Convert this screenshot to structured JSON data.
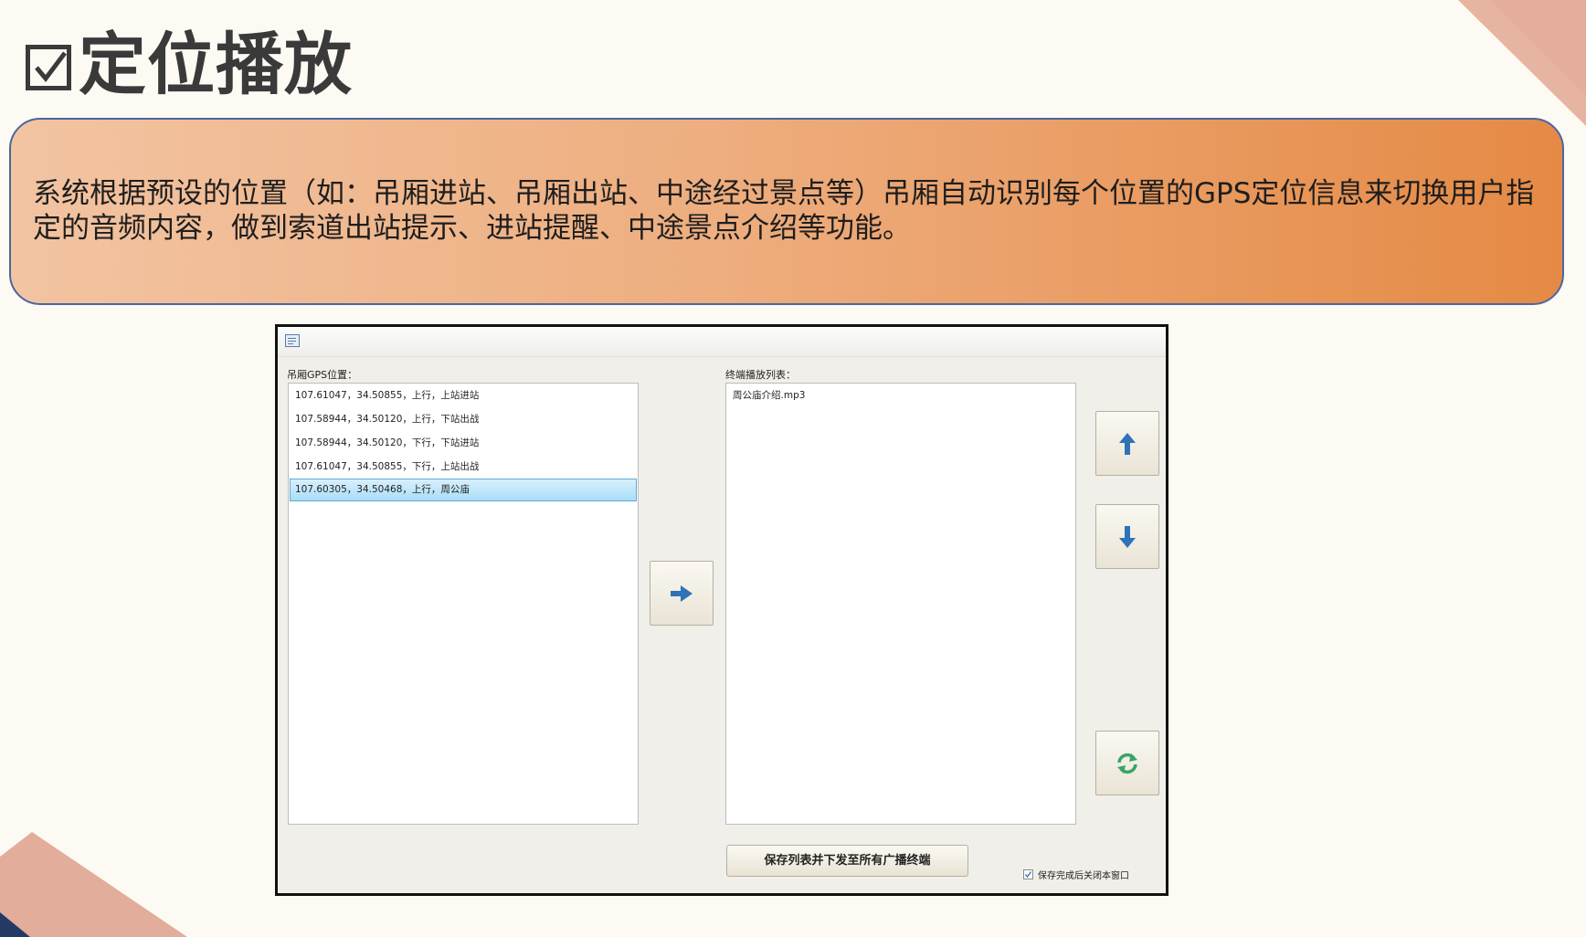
{
  "slide": {
    "title": "定位播放",
    "description": "系统根据预设的位置（如：吊厢进站、吊厢出站、中途经过景点等）吊厢自动识别每个位置的GPS定位信息来切换用户指定的音频内容，做到索道出站提示、进站提醒、中途景点介绍等功能。"
  },
  "dialog": {
    "gps_list_label": "吊厢GPS位置：",
    "gps_list": [
      "107.61047，34.50855，上行，上站进站",
      "107.58944，34.50120，上行，下站出战",
      "107.58944，34.50120，下行，下站进站",
      "107.61047，34.50855，下行，上站出战",
      "107.60305，34.50468，上行，周公庙"
    ],
    "gps_selected_index": 4,
    "playlist_label": "终端播放列表：",
    "playlist": [
      "周公庙介绍.mp3"
    ],
    "save_button_label": "保存列表并下发至所有广播终端",
    "close_after_save_label": "保存完成后关闭本窗口",
    "close_after_save_checked": true
  },
  "colors": {
    "banner_start": "#f2c4a2",
    "banner_end": "#e58a45",
    "banner_border": "#4a66a0",
    "arrow_blue": "#2f72b8",
    "refresh_green": "#3aa46a",
    "selection_blue": "#a9ddf7"
  },
  "icons": [
    "checkbox-title-icon",
    "window-icon",
    "arrow-right-icon",
    "arrow-up-icon",
    "arrow-down-icon",
    "refresh-icon"
  ]
}
